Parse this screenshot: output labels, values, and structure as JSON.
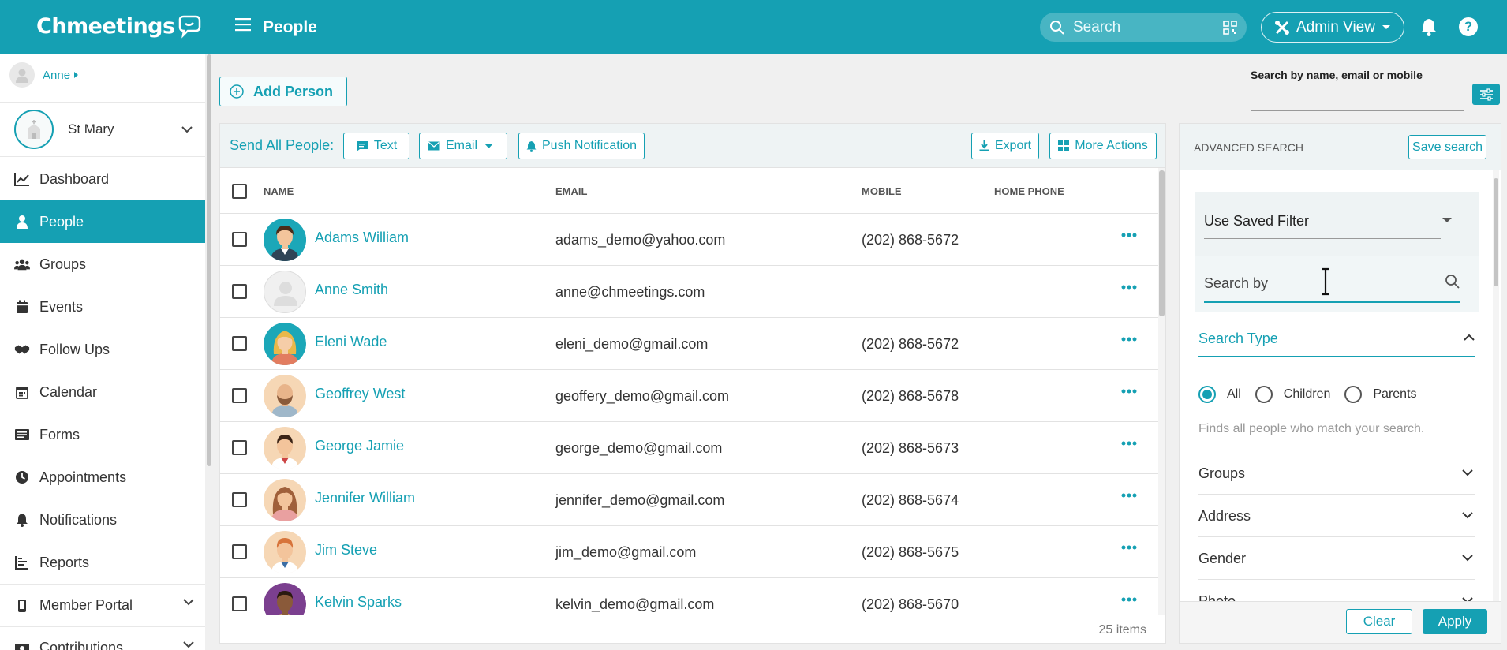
{
  "app": {
    "logo": "Chmeetings",
    "page_title": "People"
  },
  "topbar": {
    "search_placeholder": "Search",
    "admin_view": "Admin View",
    "help": "?"
  },
  "sidebar": {
    "user": "Anne",
    "church": "St Mary",
    "items": [
      {
        "label": "Dashboard",
        "icon": "chart-line-icon"
      },
      {
        "label": "People",
        "icon": "person-icon",
        "active": true
      },
      {
        "label": "Groups",
        "icon": "users-icon"
      },
      {
        "label": "Events",
        "icon": "calendar-icon"
      },
      {
        "label": "Follow Ups",
        "icon": "handshake-icon"
      },
      {
        "label": "Calendar",
        "icon": "calendar-grid-icon"
      },
      {
        "label": "Forms",
        "icon": "form-icon"
      },
      {
        "label": "Appointments",
        "icon": "clock-icon"
      },
      {
        "label": "Notifications",
        "icon": "bell-icon"
      },
      {
        "label": "Reports",
        "icon": "report-icon"
      },
      {
        "label": "Member Portal",
        "icon": "mobile-icon",
        "expandable": true
      },
      {
        "label": "Contributions",
        "icon": "money-icon",
        "expandable": true
      }
    ]
  },
  "toolbar": {
    "add_person": "Add Person",
    "search_label": "Search by name, email or mobile"
  },
  "send_bar": {
    "label": "Send All People:",
    "text": "Text",
    "email": "Email",
    "push": "Push Notification",
    "export": "Export",
    "more": "More Actions"
  },
  "table": {
    "headers": {
      "name": "NAME",
      "email": "EMAIL",
      "mobile": "MOBILE",
      "home": "HOME PHONE"
    },
    "rows": [
      {
        "name": "Adams William",
        "email": "adams_demo@yahoo.com",
        "mobile": "(202) 868-5672",
        "avatar": "man-suit"
      },
      {
        "name": "Anne Smith",
        "email": "anne@chmeetings.com",
        "mobile": "",
        "avatar": "placeholder"
      },
      {
        "name": "Eleni Wade",
        "email": "eleni_demo@gmail.com",
        "mobile": "(202) 868-5672",
        "avatar": "woman-blonde"
      },
      {
        "name": "Geoffrey West",
        "email": "geoffery_demo@gmail.com",
        "mobile": "(202) 868-5678",
        "avatar": "man-bald-beard"
      },
      {
        "name": "George Jamie",
        "email": "george_demo@gmail.com",
        "mobile": "(202) 868-5673",
        "avatar": "man-dark-hair"
      },
      {
        "name": "Jennifer William",
        "email": "jennifer_demo@gmail.com",
        "mobile": "(202) 868-5674",
        "avatar": "woman-brown"
      },
      {
        "name": "Jim Steve",
        "email": "jim_demo@gmail.com",
        "mobile": "(202) 868-5675",
        "avatar": "man-ginger"
      },
      {
        "name": "Kelvin Sparks",
        "email": "kelvin_demo@gmail.com",
        "mobile": "(202) 868-5670",
        "avatar": "man-dark-skin"
      }
    ],
    "count": "25 items"
  },
  "advanced": {
    "title": "ADVANCED SEARCH",
    "save_search": "Save search",
    "saved_filter": "Use Saved Filter",
    "search_by": "Search by",
    "search_type": "Search Type",
    "radios": [
      "All",
      "Children",
      "Parents"
    ],
    "selected": "All",
    "hint": "Finds all people who match your search.",
    "sections": [
      "Groups",
      "Address",
      "Gender",
      "Photo"
    ],
    "clear": "Clear",
    "apply": "Apply"
  },
  "colors": {
    "accent": "#15a0b3"
  }
}
